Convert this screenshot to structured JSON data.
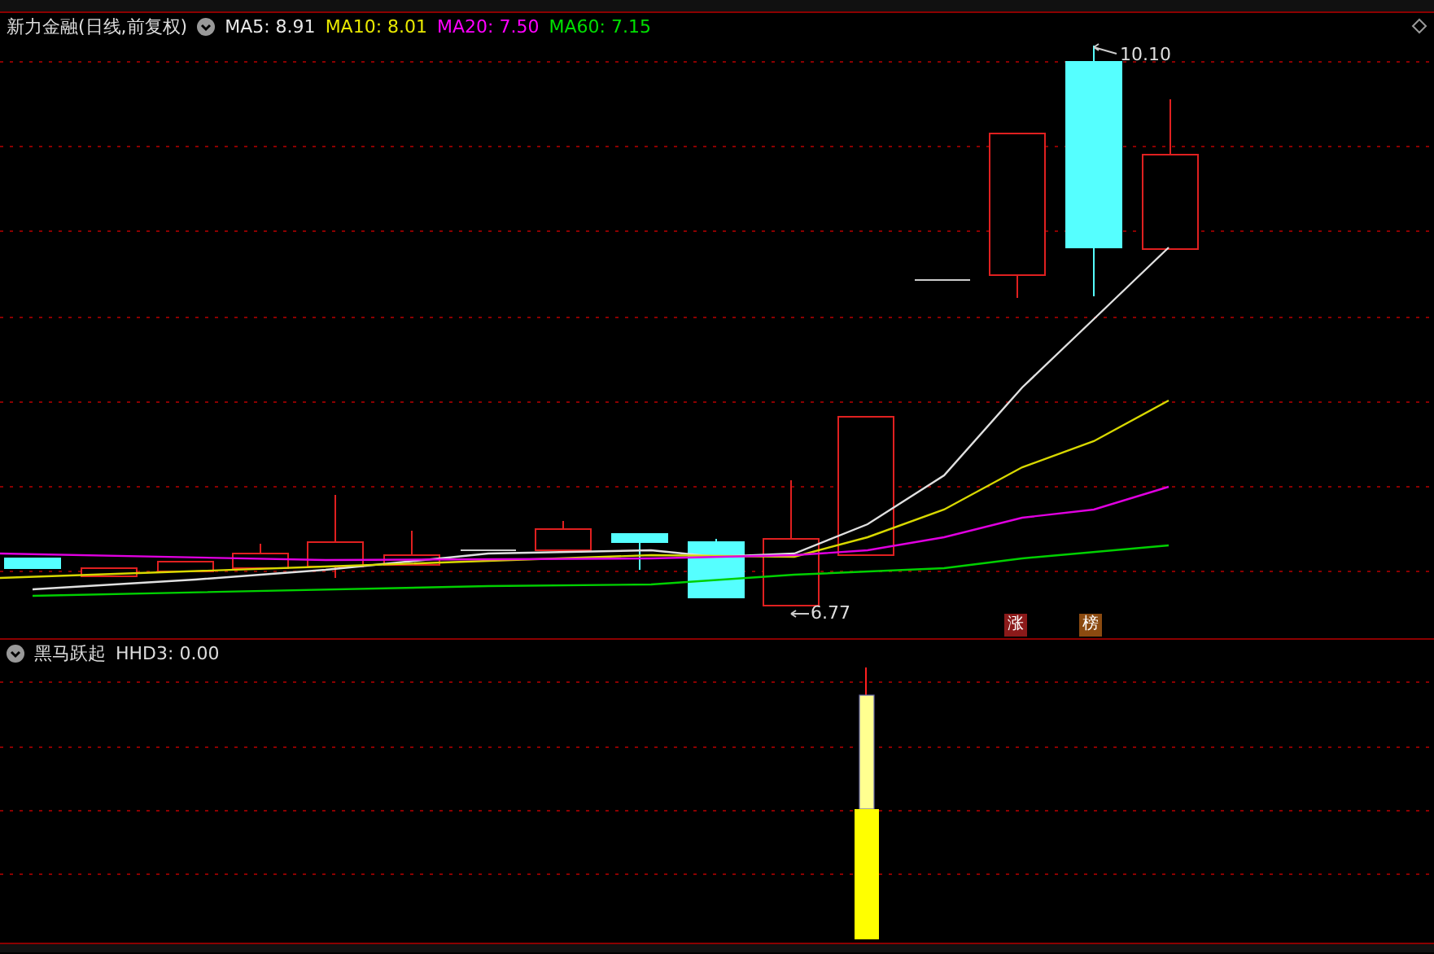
{
  "header": {
    "title": "新力金融(日线,前复权)",
    "ma": [
      {
        "label": "MA5: 8.91",
        "color": "#e8e8e8"
      },
      {
        "label": "MA10: 8.01",
        "color": "#e8e800"
      },
      {
        "label": "MA20: 7.50",
        "color": "#ff00ff"
      },
      {
        "label": "MA60: 7.15",
        "color": "#00e000"
      }
    ]
  },
  "chart": {
    "high_label": "10.10",
    "low_label": "6.77",
    "badges": [
      {
        "text": "涨",
        "color": "#8b1a1a"
      },
      {
        "text": "榜",
        "color": "#8b4a10"
      }
    ]
  },
  "indicator": {
    "title": "黑马跃起",
    "value": "HHD3: 0.00"
  }
}
